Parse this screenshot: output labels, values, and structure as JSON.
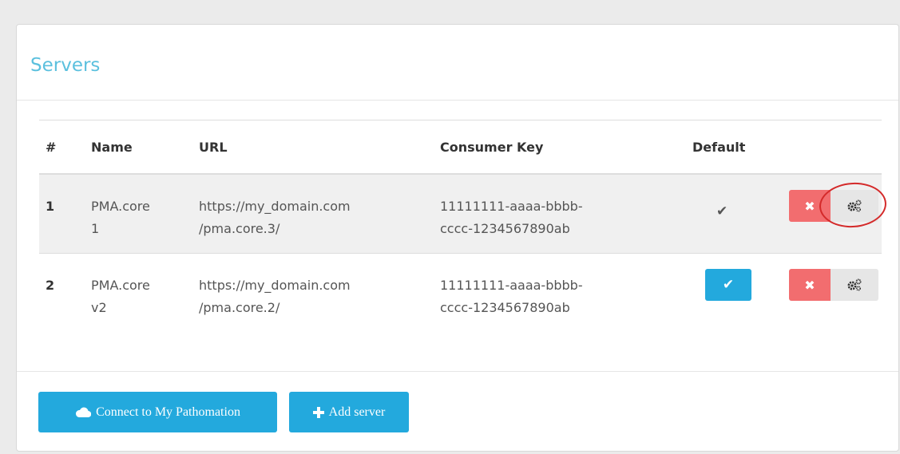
{
  "panel": {
    "title": "Servers"
  },
  "table": {
    "headers": [
      "#",
      "Name",
      "URL",
      "Consumer Key",
      "Default",
      ""
    ],
    "rows": [
      {
        "index": "1",
        "name_line1": "PMA.core",
        "name_line2": "1",
        "url_line1": "https://my_domain.com",
        "url_line2": "/pma.core.3/",
        "key_line1": "11111111-aaaa-bbbb-",
        "key_line2": "cccc-1234567890ab",
        "default": "✔",
        "is_default": true,
        "delete_label": "✖"
      },
      {
        "index": "2",
        "name_line1": "PMA.core",
        "name_line2": "v2",
        "url_line1": "https://my_domain.com",
        "url_line2": "/pma.core.2/",
        "key_line1": "11111111-aaaa-bbbb-",
        "key_line2": "cccc-1234567890ab",
        "set_default_label": "✔",
        "is_default": false,
        "delete_label": "✖"
      }
    ]
  },
  "footer": {
    "connect_label": "Connect to My Pathomation",
    "add_label": "Add server"
  },
  "icons": {
    "check": "check-icon",
    "delete": "times-icon",
    "settings": "cogs-icon",
    "cloud": "cloud-icon",
    "plus": "plus-icon"
  },
  "colors": {
    "title": "#5bc0de",
    "primary": "#23a9dd",
    "danger": "#f26d6f",
    "annotation": "#d42a2a"
  }
}
